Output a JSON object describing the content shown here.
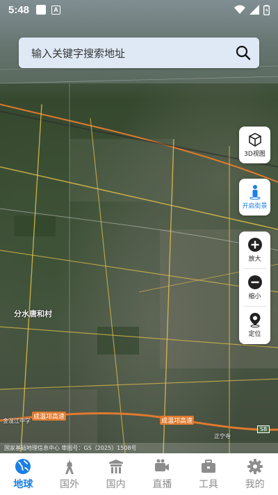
{
  "status_bar": {
    "time": "5:48",
    "a_badge": "A"
  },
  "search": {
    "placeholder": "输入关键字搜索地址"
  },
  "map_controls": {
    "view_3d": "3D视图",
    "street_view": "开启街景",
    "zoom_in": "放大",
    "zoom_out": "缩小",
    "locate": "定位"
  },
  "map_labels": {
    "village1": "分水唐和村",
    "road1": "成温邛高速",
    "road2": "成温邛高速",
    "shield": "S8",
    "school": "金温江中学",
    "label_zhengning": "正宁寺"
  },
  "attribution": "国家基础地理信息中心  审图号：GS（2025）1508号",
  "nav": [
    {
      "label": "地球",
      "icon": "globe-icon",
      "active": true
    },
    {
      "label": "国外",
      "icon": "tower-icon",
      "active": false
    },
    {
      "label": "国内",
      "icon": "temple-icon",
      "active": false
    },
    {
      "label": "直播",
      "icon": "camera-icon",
      "active": false
    },
    {
      "label": "工具",
      "icon": "toolbox-icon",
      "active": false
    },
    {
      "label": "我的",
      "icon": "gear-icon",
      "active": false
    }
  ],
  "colors": {
    "accent": "#1a7fe6",
    "road": "#e6c24a",
    "highway_orange": "#e07a2e"
  }
}
